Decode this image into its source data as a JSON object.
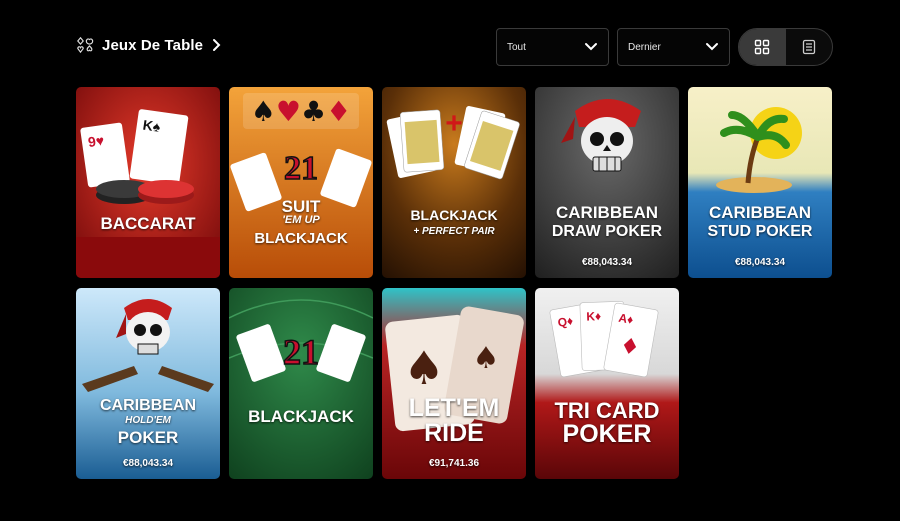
{
  "header": {
    "title": "Jeux De Table",
    "filter": "Tout",
    "sort": "Dernier"
  },
  "games": [
    {
      "name_lines": [
        "BACCARAT"
      ],
      "jackpot": ""
    },
    {
      "name_lines": [
        "SUIT",
        "'EM UP",
        "BLACKJACK"
      ],
      "jackpot": ""
    },
    {
      "name_lines": [
        "BLACKJACK",
        "+ PERFECT PAIR"
      ],
      "jackpot": ""
    },
    {
      "name_lines": [
        "CARIBBEAN",
        "DRAW POKER"
      ],
      "jackpot": "€88,043.34"
    },
    {
      "name_lines": [
        "CARIBBEAN",
        "STUD POKER"
      ],
      "jackpot": "€88,043.34"
    },
    {
      "name_lines": [
        "CARIBBEAN",
        "HOLD'EM",
        "POKER"
      ],
      "jackpot": "€88,043.34"
    },
    {
      "name_lines": [
        "BLACKJACK"
      ],
      "jackpot": ""
    },
    {
      "name_lines": [
        "LET'EM",
        "RIDE"
      ],
      "jackpot": "€91,741.36"
    },
    {
      "name_lines": [
        "TRI CARD",
        "POKER"
      ],
      "jackpot": ""
    }
  ]
}
